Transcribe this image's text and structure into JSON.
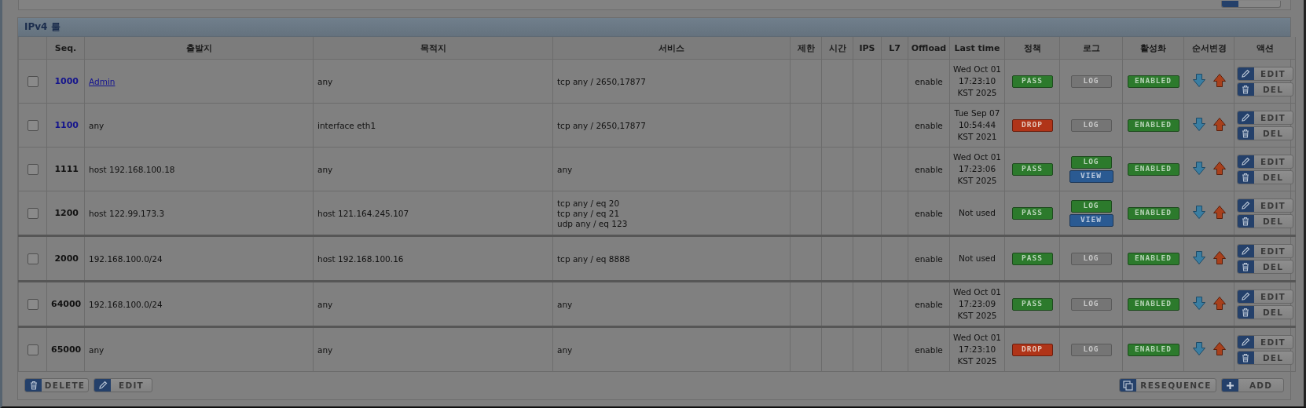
{
  "panel": {
    "title": "IPv4 룰"
  },
  "columns": [
    "Seq.",
    "출발지",
    "목적지",
    "서비스",
    "제한",
    "시간",
    "IPS",
    "L7",
    "Offload",
    "Last time",
    "정책",
    "로그",
    "활성화",
    "순서변경",
    "액션"
  ],
  "rows": [
    {
      "checked": false,
      "seq": "1000",
      "color": "#14148c",
      "source": "Admin",
      "source_link": true,
      "destination": "any",
      "service": [
        "tcp any / 2650,17877"
      ],
      "offload": "enable",
      "last_time": [
        "Wed Oct 01",
        "17:23:10",
        "KST 2025"
      ],
      "policy": {
        "label": "PASS",
        "kind": "pass"
      },
      "log": {
        "label": "LOG",
        "on": false
      },
      "enabled": "ENABLED",
      "edit": "EDIT",
      "delete": "DEL",
      "group_end": false
    },
    {
      "checked": false,
      "seq": "1100",
      "color": "#14148c",
      "source": "any",
      "source_link": false,
      "destination": "interface eth1",
      "service": [
        "tcp any / 2650,17877"
      ],
      "offload": "enable",
      "last_time": [
        "Tue Sep 07",
        "10:54:44",
        "KST 2021"
      ],
      "policy": {
        "label": "DROP",
        "kind": "drop"
      },
      "log": {
        "label": "LOG",
        "on": false
      },
      "enabled": "ENABLED",
      "edit": "EDIT",
      "delete": "DEL",
      "group_end": false
    },
    {
      "checked": false,
      "seq": "1111",
      "color": "#111111",
      "source": "host 192.168.100.18",
      "source_link": false,
      "destination": "any",
      "service": [
        "any"
      ],
      "offload": "enable",
      "last_time": [
        "Wed Oct 01",
        "17:23:06",
        "KST 2025"
      ],
      "policy": {
        "label": "PASS",
        "kind": "pass"
      },
      "log": {
        "label": "LOG",
        "on": true,
        "view": "VIEW"
      },
      "enabled": "ENABLED",
      "edit": "EDIT",
      "delete": "DEL",
      "group_end": false
    },
    {
      "checked": false,
      "seq": "1200",
      "color": "#111111",
      "source": "host 122.99.173.3",
      "source_link": false,
      "destination": "host 121.164.245.107",
      "service": [
        "tcp any / eq 20",
        "tcp any / eq 21",
        "udp any / eq 123"
      ],
      "offload": "enable",
      "last_time": [
        "Not used"
      ],
      "policy": {
        "label": "PASS",
        "kind": "pass"
      },
      "log": {
        "label": "LOG",
        "on": true,
        "view": "VIEW"
      },
      "enabled": "ENABLED",
      "edit": "EDIT",
      "delete": "DEL",
      "group_end": true
    },
    {
      "checked": false,
      "seq": "2000",
      "color": "#111111",
      "source": "192.168.100.0/24",
      "source_link": false,
      "destination": "host 192.168.100.16",
      "service": [
        "tcp any / eq 8888"
      ],
      "offload": "enable",
      "last_time": [
        "Not used"
      ],
      "policy": {
        "label": "PASS",
        "kind": "pass"
      },
      "log": {
        "label": "LOG",
        "on": false
      },
      "enabled": "ENABLED",
      "edit": "EDIT",
      "delete": "DEL",
      "group_end": true
    },
    {
      "checked": false,
      "seq": "64000",
      "color": "#111111",
      "source": "192.168.100.0/24",
      "source_link": false,
      "destination": "any",
      "service": [
        "any"
      ],
      "offload": "enable",
      "last_time": [
        "Wed Oct 01",
        "17:23:09",
        "KST 2025"
      ],
      "policy": {
        "label": "PASS",
        "kind": "pass"
      },
      "log": {
        "label": "LOG",
        "on": false
      },
      "enabled": "ENABLED",
      "edit": "EDIT",
      "delete": "DEL",
      "group_end": true
    },
    {
      "checked": false,
      "seq": "65000",
      "color": "#111111",
      "source": "any",
      "source_link": false,
      "destination": "any",
      "service": [
        "any"
      ],
      "offload": "enable",
      "last_time": [
        "Wed Oct 01",
        "17:23:10",
        "KST 2025"
      ],
      "policy": {
        "label": "DROP",
        "kind": "drop"
      },
      "log": {
        "label": "LOG",
        "on": false
      },
      "enabled": "ENABLED",
      "edit": "EDIT",
      "delete": "DEL",
      "group_end": false
    }
  ],
  "footer_left": [
    "DELETE",
    "EDIT"
  ],
  "footer_right": [
    "RESEQUENCE",
    "ADD"
  ]
}
